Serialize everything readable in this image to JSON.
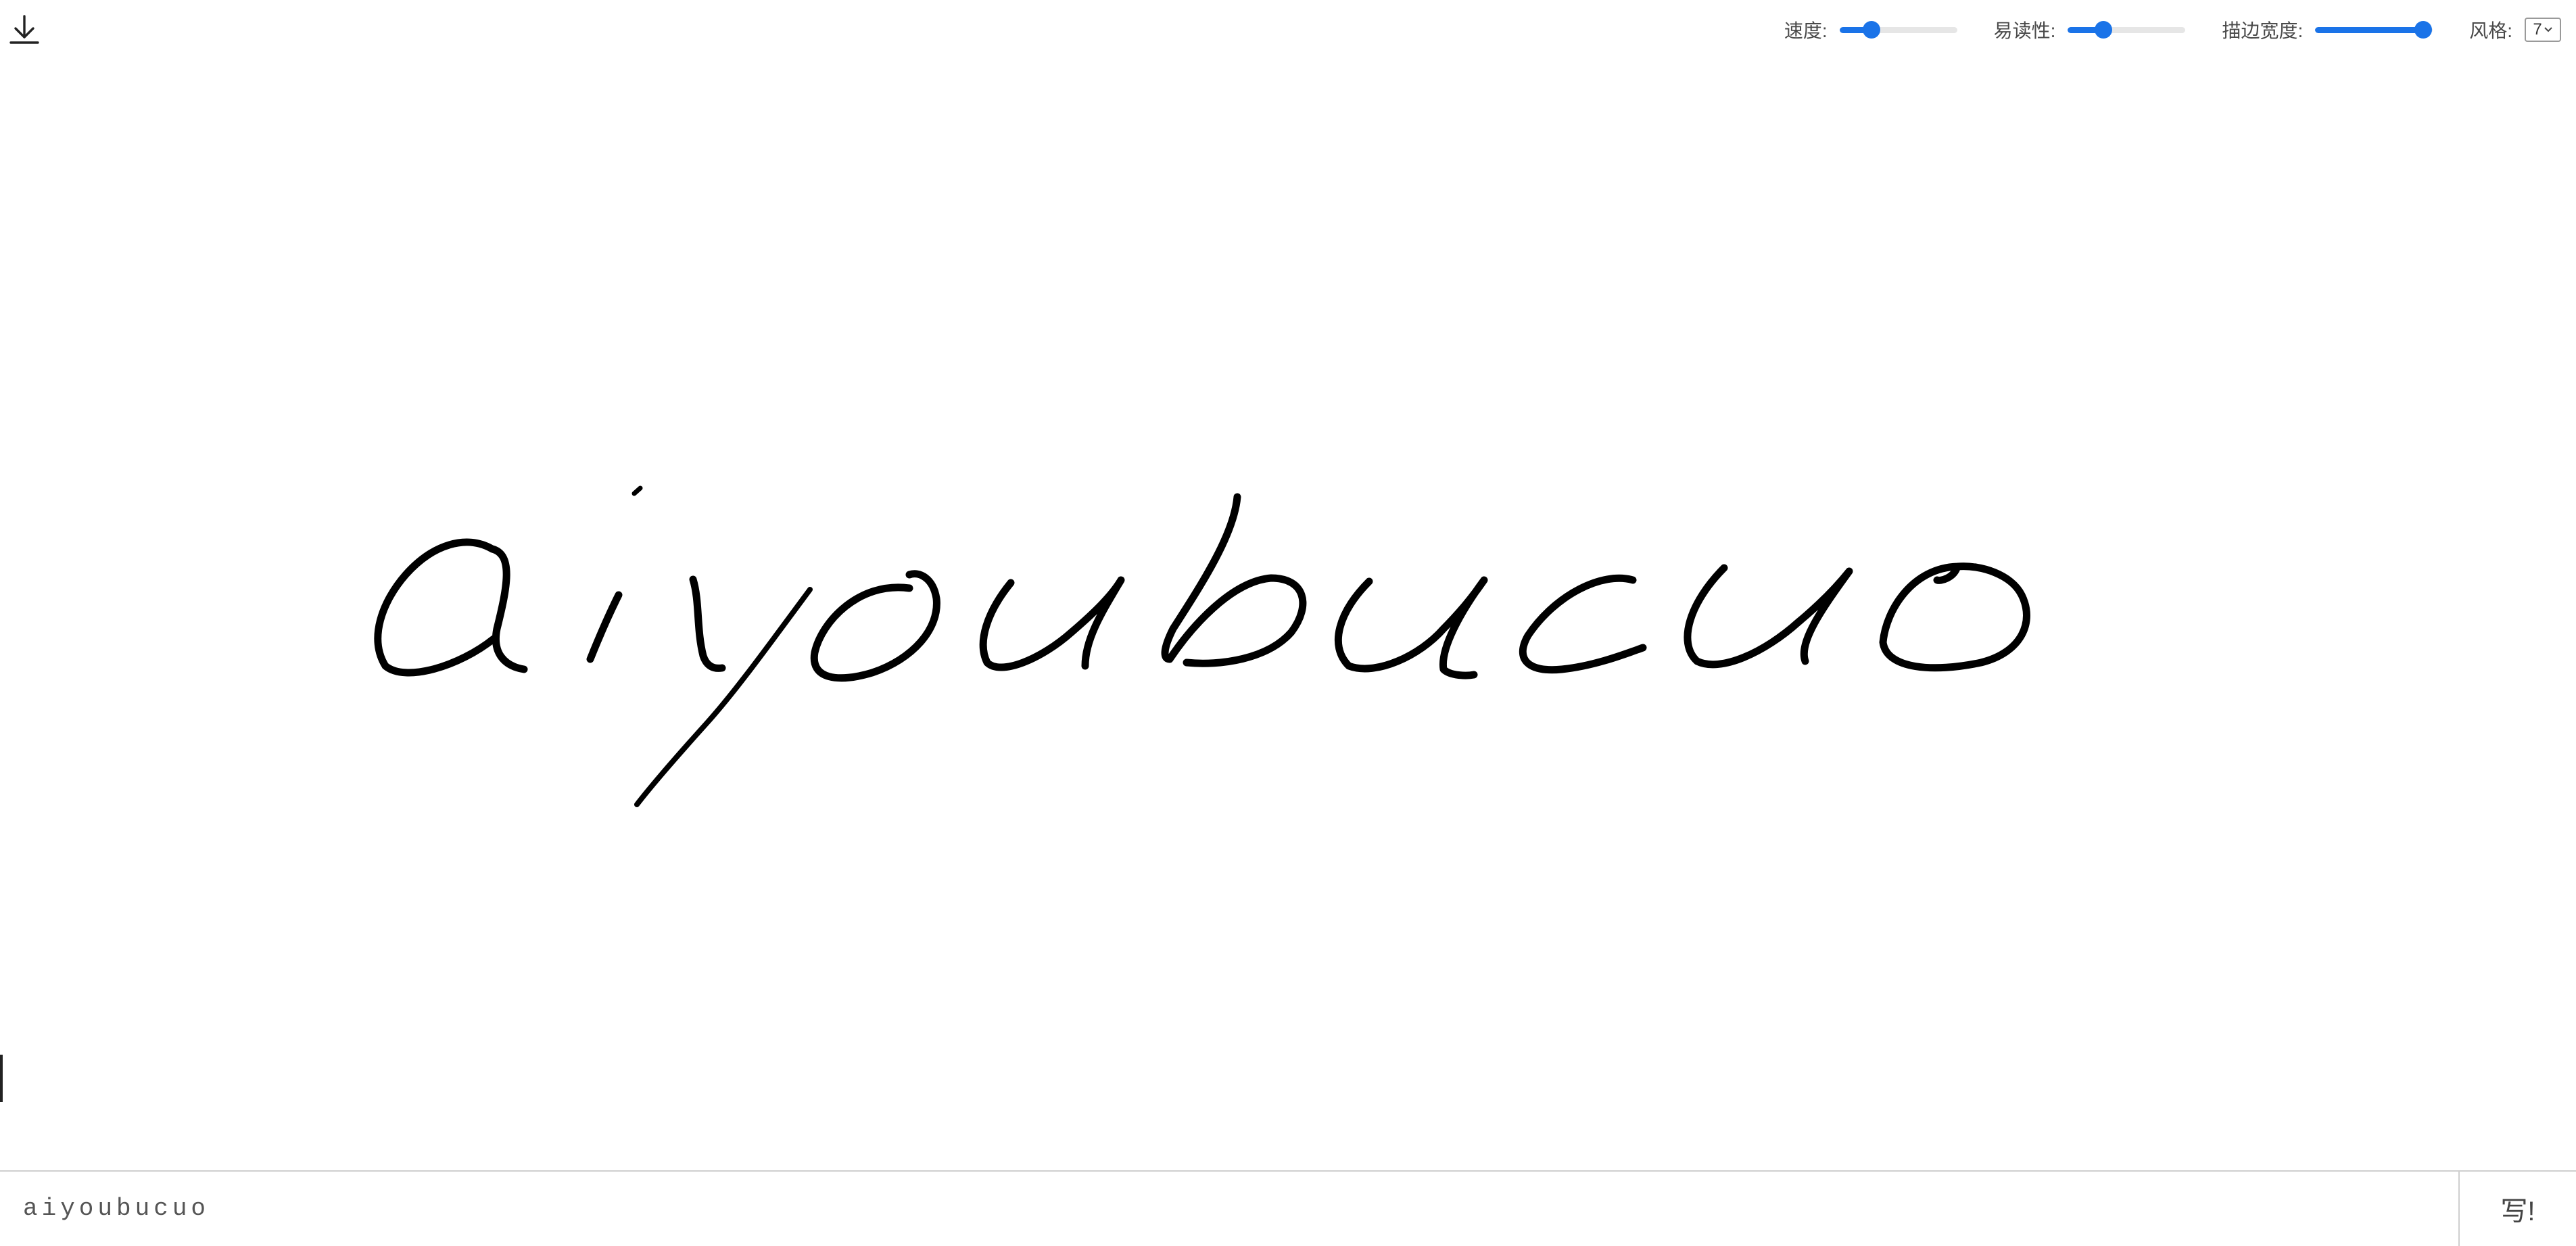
{
  "toolbar": {
    "download_icon": "download-icon",
    "speed": {
      "label": "速度:",
      "value": 0.27
    },
    "legibility": {
      "label": "易读性:",
      "value": 0.3
    },
    "stroke_width": {
      "label": "描边宽度:",
      "value": 0.92
    },
    "style": {
      "label": "风格:",
      "selected": "7"
    },
    "accent_color": "#1a73e8"
  },
  "canvas": {
    "handwritten_text": "aiyoubucuo",
    "ink_color": "#000000"
  },
  "input": {
    "value": "aiyoubucuo"
  },
  "write_button": {
    "label": "写!"
  }
}
